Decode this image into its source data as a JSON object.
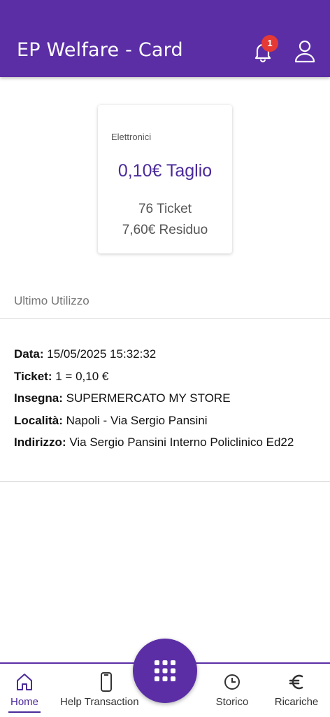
{
  "header": {
    "title": "EP Welfare - Card",
    "notification_count": "1"
  },
  "card": {
    "category": "Elettronici",
    "taglio": "0,10€ Taglio",
    "tickets": "76 Ticket",
    "residuo": "7,60€ Residuo"
  },
  "last_usage": {
    "section_title": "Ultimo Utilizzo",
    "data_label": "Data:",
    "data_value": "15/05/2025 15:32:32",
    "ticket_label": "Ticket:",
    "ticket_value": "1 = 0,10 €",
    "insegna_label": "Insegna:",
    "insegna_value": "SUPERMERCATO MY STORE",
    "localita_label": "Località:",
    "localita_value": "Napoli - Via Sergio Pansini",
    "indirizzo_label": "Indirizzo:",
    "indirizzo_value": "Via Sergio Pansini Interno Policlinico Ed22"
  },
  "nav": {
    "items": [
      {
        "label": "Home",
        "icon": "home-icon",
        "active": true
      },
      {
        "label": "Help Transaction",
        "icon": "phone-icon",
        "active": false
      },
      {
        "label": "Storico",
        "icon": "clock-icon",
        "active": false
      },
      {
        "label": "Ricariche",
        "icon": "euro-icon",
        "active": false
      }
    ],
    "fab_icon": "grid-icon"
  },
  "colors": {
    "primary": "#5b2ea6",
    "accent_text": "#4b2a9a",
    "badge": "#e53935"
  }
}
